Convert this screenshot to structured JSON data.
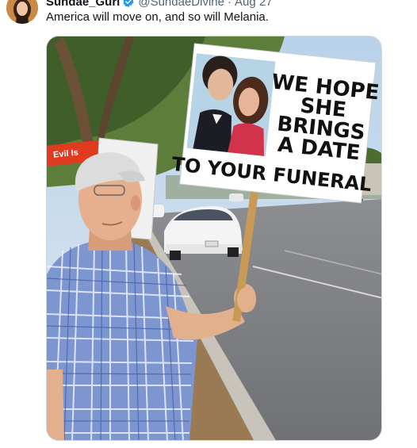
{
  "tweet": {
    "display_name": "Sundae_Gurl",
    "handle": "@SundaeDivine",
    "separator": "·",
    "date": "Aug 27",
    "text": "America will move on, and so will Melania."
  },
  "photo": {
    "sign_lines": [
      "WE HOPE",
      "SHE",
      "BRINGS",
      "A DATE",
      "TO YOUR FUNERAL"
    ],
    "rear_sign_text": "Evil Is",
    "icons": [
      "verified-badge-icon"
    ]
  },
  "colors": {
    "verified_blue": "#1d9bf0",
    "text_primary": "#0f1419",
    "text_secondary": "#536471"
  }
}
